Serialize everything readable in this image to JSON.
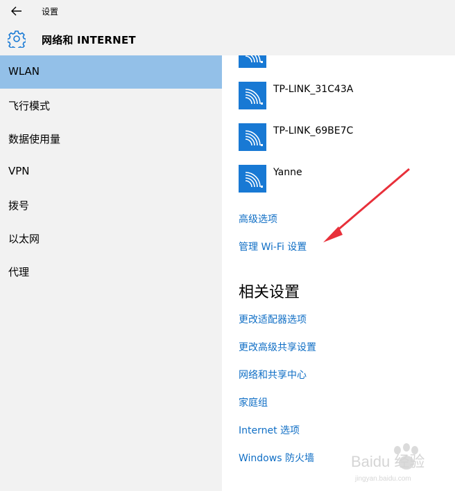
{
  "window": {
    "title": "设置"
  },
  "header": {
    "section_title": "网络和 INTERNET"
  },
  "sidebar": {
    "items": [
      {
        "label": "WLAN",
        "selected": true
      },
      {
        "label": "飞行模式",
        "selected": false
      },
      {
        "label": "数据使用量",
        "selected": false
      },
      {
        "label": "VPN",
        "selected": false
      },
      {
        "label": "拨号",
        "selected": false
      },
      {
        "label": "以太网",
        "selected": false
      },
      {
        "label": "代理",
        "selected": false
      }
    ]
  },
  "networks": [
    {
      "name": "",
      "icon": "wifi-icon"
    },
    {
      "name": "TP-LINK_31C43A",
      "icon": "wifi-icon"
    },
    {
      "name": "TP-LINK_69BE7C",
      "icon": "wifi-icon"
    },
    {
      "name": "Yanne",
      "icon": "wifi-icon"
    }
  ],
  "links": {
    "advanced": "高级选项",
    "manage_wifi": "管理 Wi-Fi 设置"
  },
  "related": {
    "heading": "相关设置",
    "links": [
      "更改适配器选项",
      "更改高级共享设置",
      "网络和共享中心",
      "家庭组",
      "Internet 选项",
      "Windows 防火墙"
    ]
  },
  "watermark": {
    "brand": "Baidu 经验",
    "url": "jingyan.baidu.com"
  },
  "colors": {
    "accent": "#1879d4",
    "link": "#0f6ec5",
    "selected": "#93c0e8",
    "sidebar_bg": "#f2f2f2",
    "annotation_arrow": "#e8303a"
  }
}
